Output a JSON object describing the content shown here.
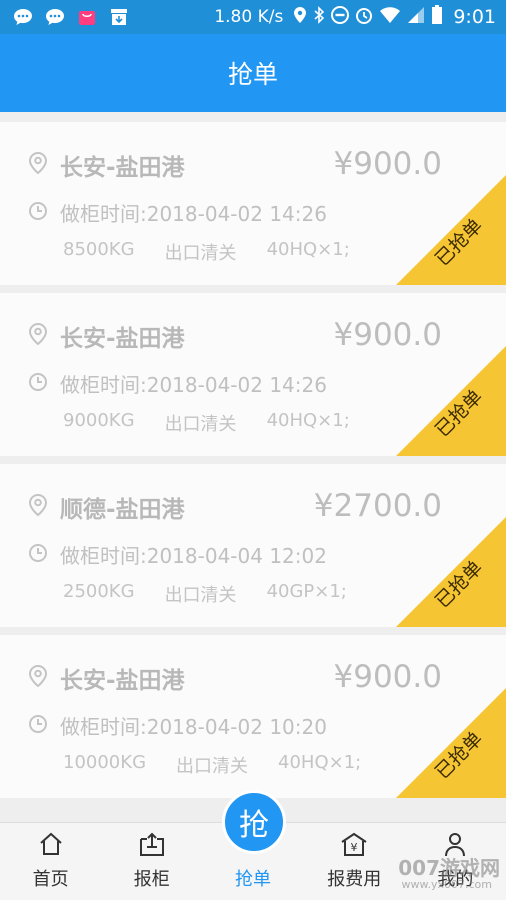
{
  "statusbar": {
    "network_speed": "1.80 K/s",
    "time": "9:01"
  },
  "appbar": {
    "title": "抢单"
  },
  "orders": [
    {
      "route": "长安-盐田港",
      "price": "¥900.0",
      "time": "做柜时间:2018-04-02 14:26",
      "weight": "8500KG",
      "type": "出口清关",
      "container": "40HQ×1;",
      "status": "已抢单"
    },
    {
      "route": "长安-盐田港",
      "price": "¥900.0",
      "time": "做柜时间:2018-04-02 14:26",
      "weight": "9000KG",
      "type": "出口清关",
      "container": "40HQ×1;",
      "status": "已抢单"
    },
    {
      "route": "顺德-盐田港",
      "price": "¥2700.0",
      "time": "做柜时间:2018-04-04 12:02",
      "weight": "2500KG",
      "type": "出口清关",
      "container": "40GP×1;",
      "status": "已抢单"
    },
    {
      "route": "长安-盐田港",
      "price": "¥900.0",
      "time": "做柜时间:2018-04-02 10:20",
      "weight": "10000KG",
      "type": "出口清关",
      "container": "40HQ×1;",
      "status": "已抢单"
    }
  ],
  "tabbar": {
    "home": "首页",
    "report_container": "报柜",
    "grab": "抢单",
    "report_fee": "报费用",
    "mine": "我的",
    "fab_label": "抢"
  },
  "watermark": {
    "main": "007游戏网",
    "url": "www.yx007.com"
  },
  "colors": {
    "primary": "#2196f3",
    "ribbon": "#f5c533"
  }
}
